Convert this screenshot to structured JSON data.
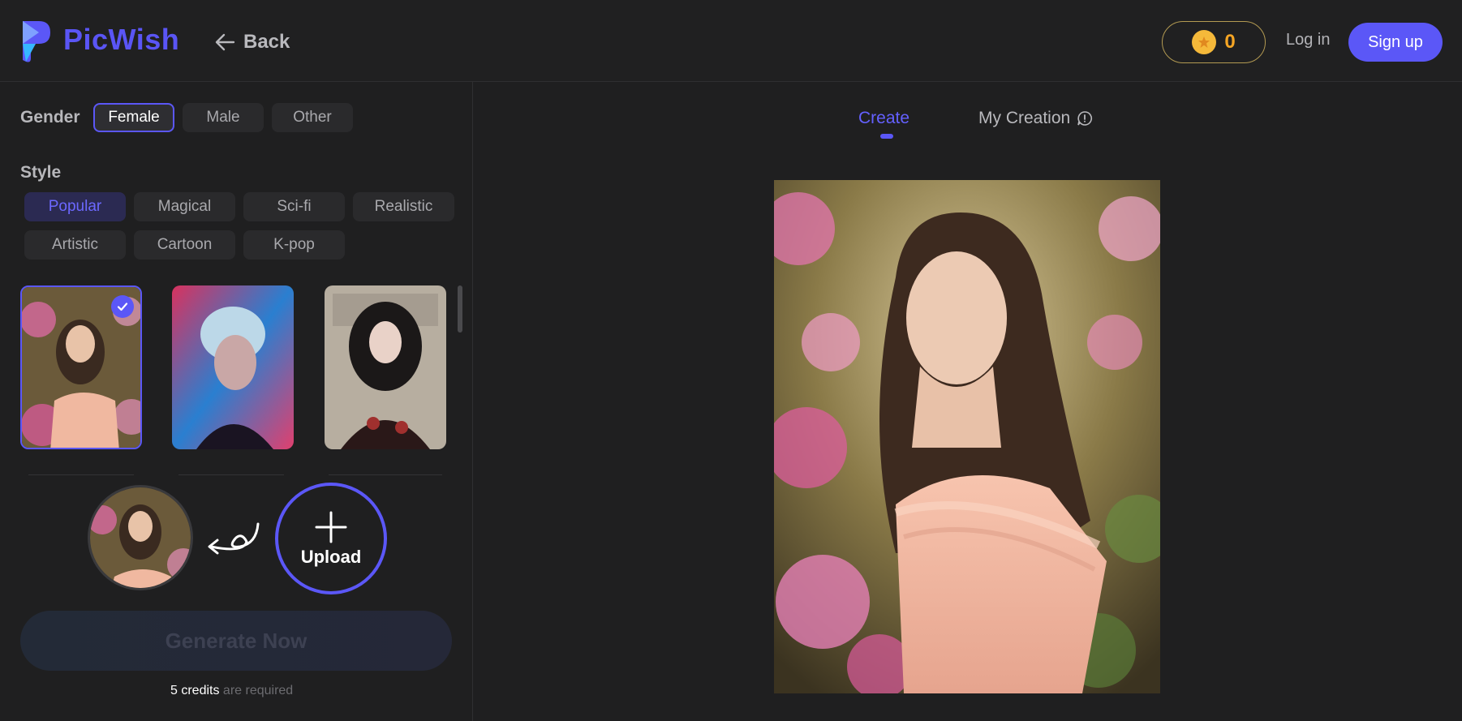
{
  "header": {
    "brand": "PicWish",
    "back_label": "Back",
    "credits": "0",
    "login_label": "Log in",
    "signup_label": "Sign up"
  },
  "left": {
    "gender_label": "Gender",
    "genders": [
      "Female",
      "Male",
      "Other"
    ],
    "selected_gender": "Female",
    "style_label": "Style",
    "styles": [
      "Popular",
      "Magical",
      "Sci-fi",
      "Realistic",
      "Artistic",
      "Cartoon",
      "K-pop"
    ],
    "selected_style": "Popular",
    "upload_label": "Upload",
    "generate_label": "Generate Now",
    "credits_required_num": "5 credits",
    "credits_required_rest": " are required"
  },
  "main": {
    "tabs": [
      "Create",
      "My Creation"
    ],
    "active_tab": "Create"
  },
  "colors": {
    "accent": "#5b57f7",
    "background": "#1f1f20",
    "coin": "#f5b93a"
  }
}
